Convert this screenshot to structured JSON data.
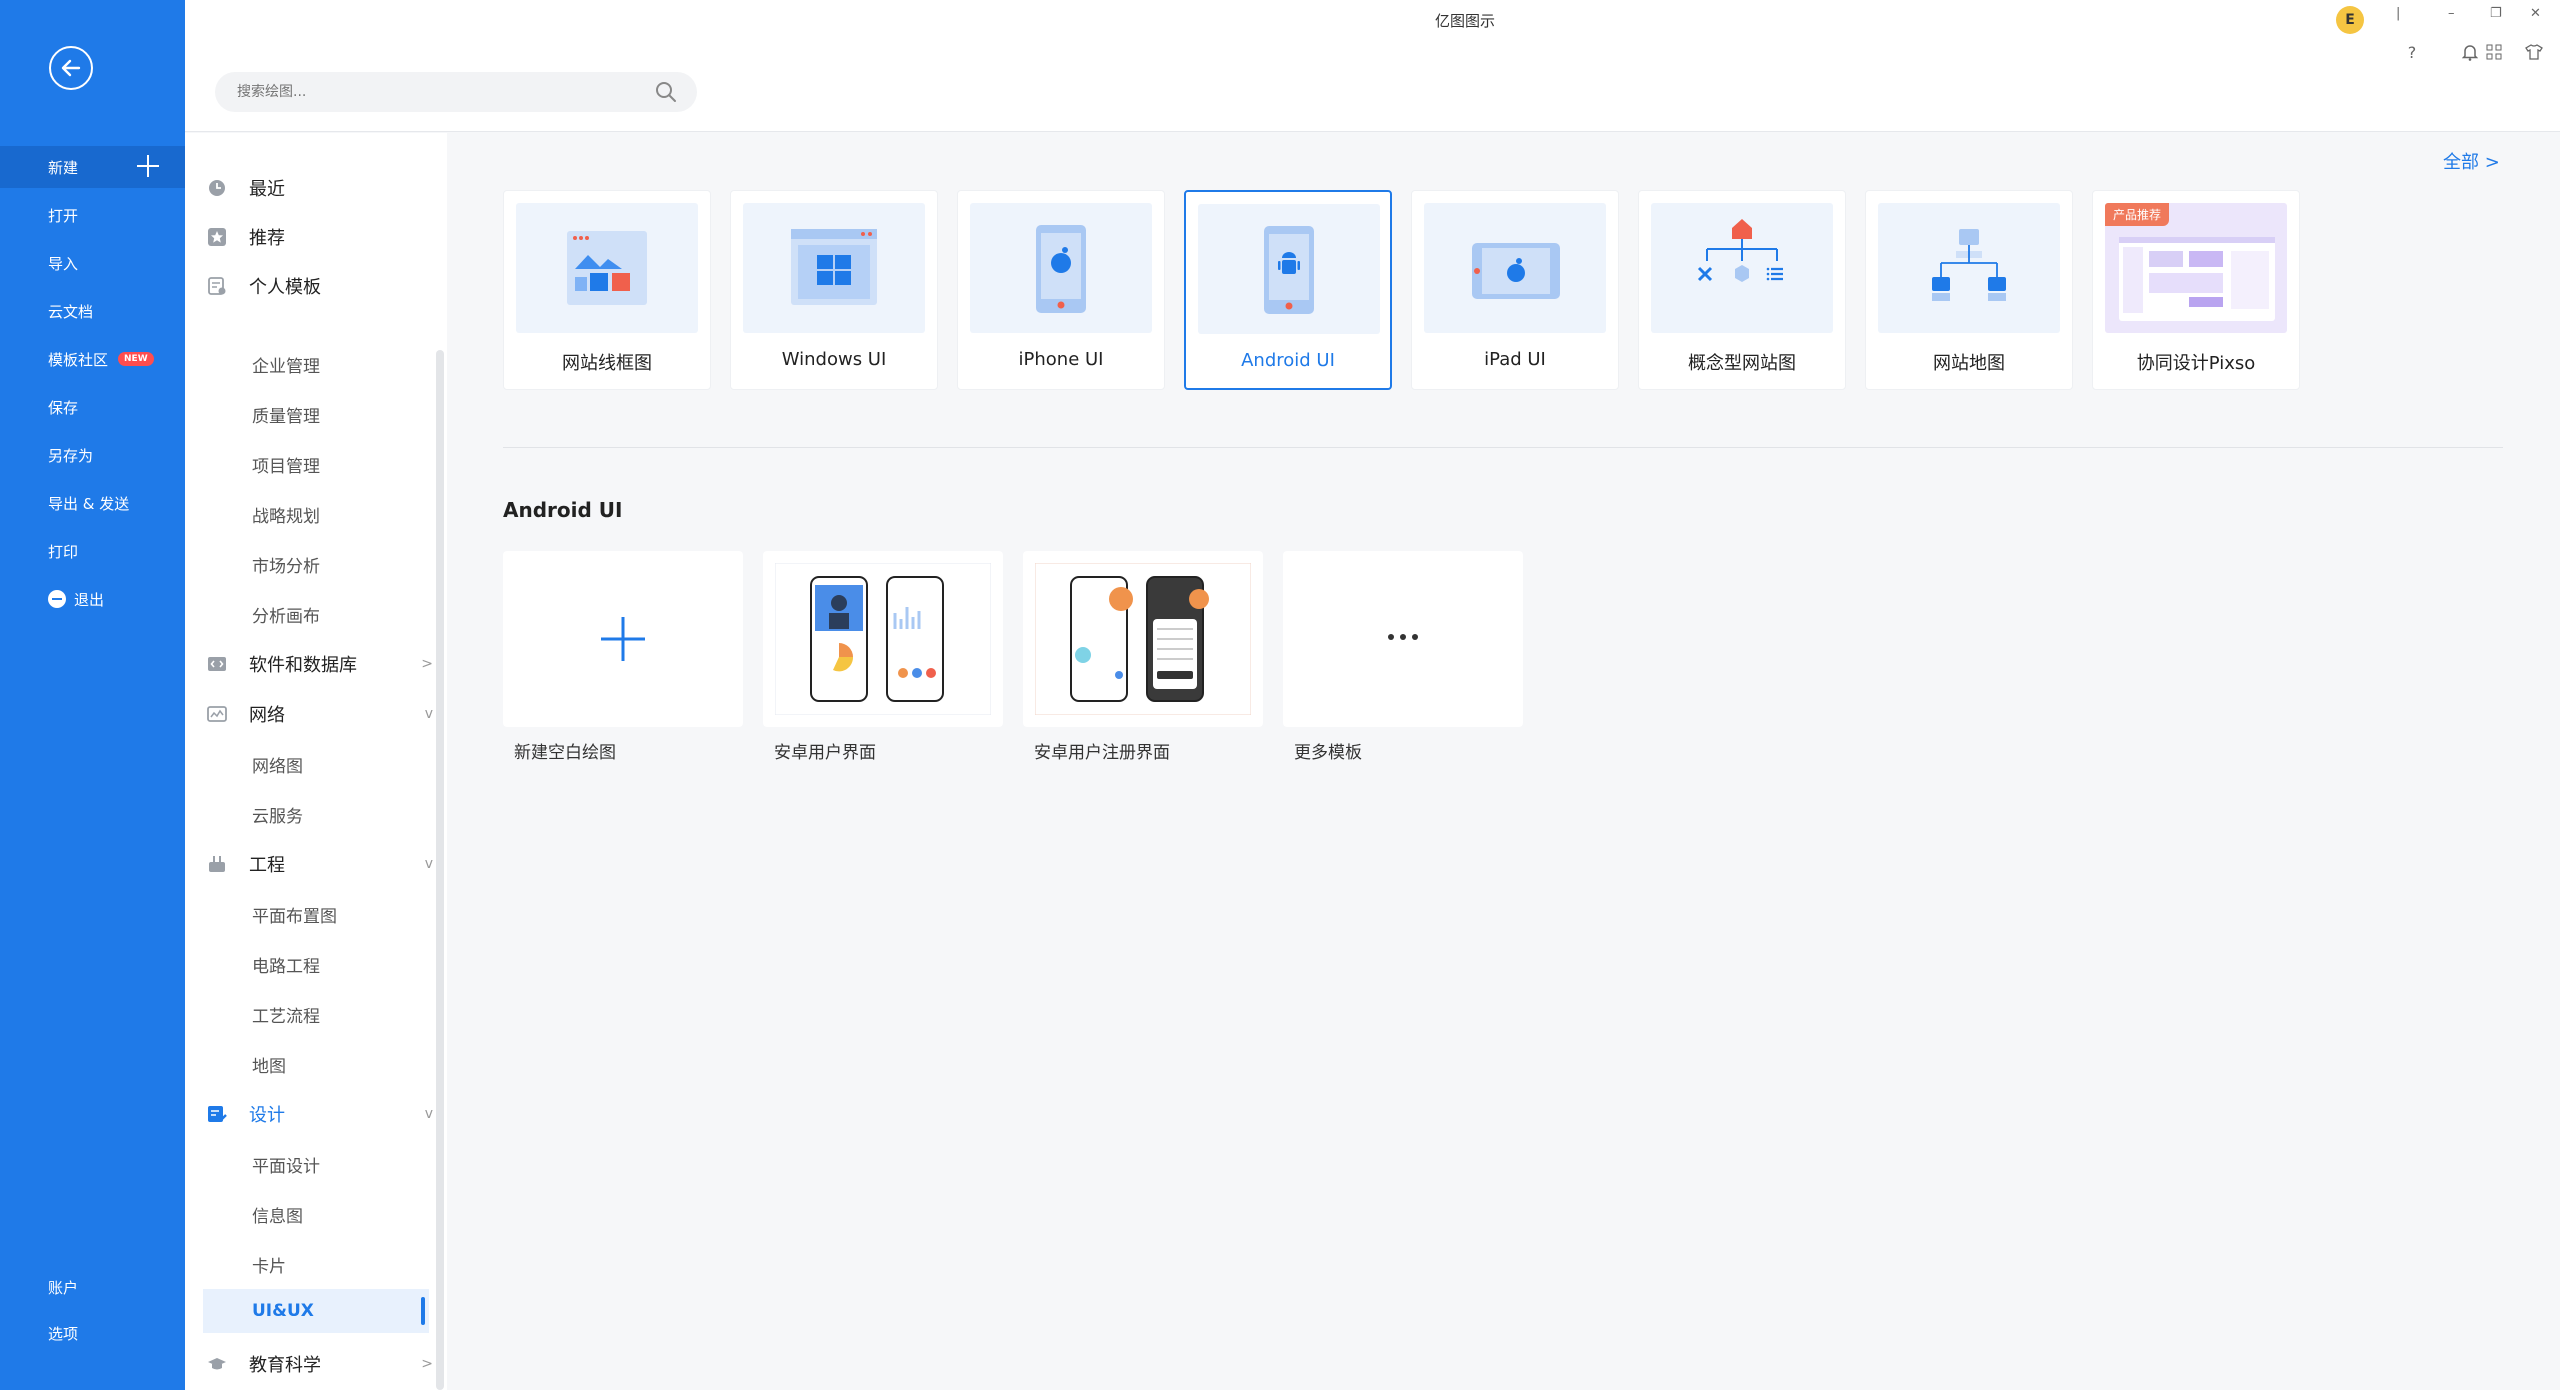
{
  "app": {
    "title": "亿图图示"
  },
  "left_menu": {
    "new_label": "新建",
    "items": [
      {
        "label": "打开"
      },
      {
        "label": "导入"
      },
      {
        "label": "云文档"
      },
      {
        "label": "模板社区",
        "badge": "NEW"
      },
      {
        "label": "保存"
      },
      {
        "label": "另存为"
      },
      {
        "label": "导出 & 发送"
      },
      {
        "label": "打印"
      },
      {
        "label": "退出"
      }
    ],
    "bottom": [
      {
        "label": "账户"
      },
      {
        "label": "选项"
      }
    ]
  },
  "search": {
    "placeholder": "搜索绘图..."
  },
  "user": {
    "avatar_initial": "E"
  },
  "categories": {
    "top": [
      {
        "label": "最近"
      },
      {
        "label": "推荐"
      },
      {
        "label": "个人模板"
      }
    ],
    "subs_a": [
      {
        "label": "企业管理"
      },
      {
        "label": "质量管理"
      },
      {
        "label": "项目管理"
      },
      {
        "label": "战略规划"
      },
      {
        "label": "市场分析"
      },
      {
        "label": "分析画布"
      }
    ],
    "groups": [
      {
        "label": "软件和数据库"
      },
      {
        "label": "网络"
      },
      {
        "label": "工程"
      },
      {
        "label": "设计"
      },
      {
        "label": "教育科学"
      }
    ],
    "network_subs": [
      {
        "label": "网络图"
      },
      {
        "label": "云服务"
      }
    ],
    "engineering_subs": [
      {
        "label": "平面布置图"
      },
      {
        "label": "电路工程"
      },
      {
        "label": "工艺流程"
      },
      {
        "label": "地图"
      }
    ],
    "design_subs": [
      {
        "label": "平面设计"
      },
      {
        "label": "信息图"
      },
      {
        "label": "卡片"
      },
      {
        "label": "UI&UX"
      }
    ]
  },
  "main": {
    "all_link": "全部  >",
    "types": [
      {
        "label": "网站线框图"
      },
      {
        "label": "Windows UI"
      },
      {
        "label": "iPhone UI"
      },
      {
        "label": "Android UI",
        "selected": true
      },
      {
        "label": "iPad UI"
      },
      {
        "label": "概念型网站图"
      },
      {
        "label": "网站地图"
      },
      {
        "label": "协同设计Pixso",
        "badge": "产品推荐"
      }
    ],
    "section_title": "Android UI",
    "templates": [
      {
        "label": "新建空白绘图"
      },
      {
        "label": "安卓用户界面"
      },
      {
        "label": "安卓用户注册界面"
      },
      {
        "label": "更多模板"
      }
    ]
  },
  "colors": {
    "primary": "#1f7ae8",
    "danger": "#f0604c",
    "promo": "#f0795b"
  }
}
